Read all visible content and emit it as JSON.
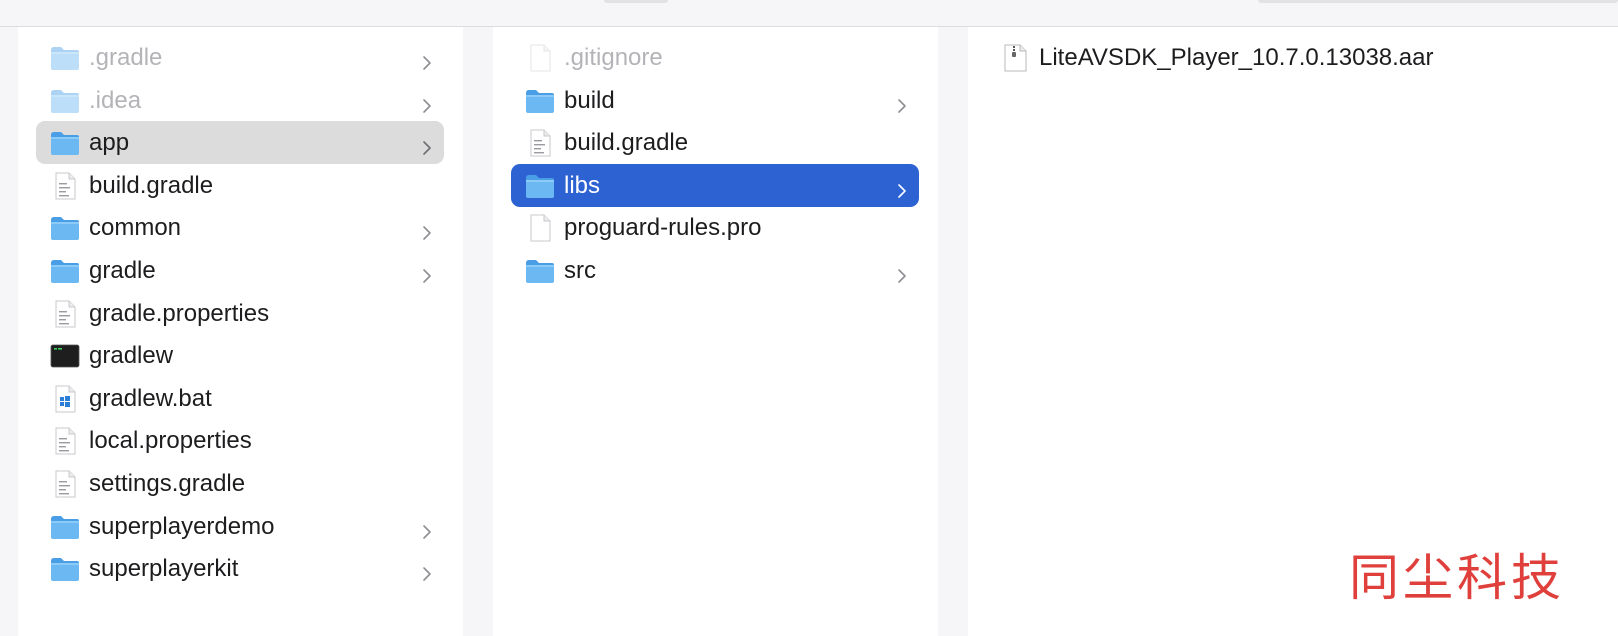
{
  "columns": [
    {
      "name": "root",
      "items": [
        {
          "label": ".gradle",
          "kind": "folder",
          "dim": true,
          "chevron": true,
          "state": "none"
        },
        {
          "label": ".idea",
          "kind": "folder",
          "dim": true,
          "chevron": true,
          "state": "none"
        },
        {
          "label": "app",
          "kind": "folder",
          "dim": false,
          "chevron": true,
          "state": "gray"
        },
        {
          "label": "build.gradle",
          "kind": "textfile",
          "dim": false,
          "chevron": false,
          "state": "none"
        },
        {
          "label": "common",
          "kind": "folder",
          "dim": false,
          "chevron": true,
          "state": "none"
        },
        {
          "label": "gradle",
          "kind": "folder",
          "dim": false,
          "chevron": true,
          "state": "none"
        },
        {
          "label": "gradle.properties",
          "kind": "textfile",
          "dim": false,
          "chevron": false,
          "state": "none"
        },
        {
          "label": "gradlew",
          "kind": "terminal",
          "dim": false,
          "chevron": false,
          "state": "none"
        },
        {
          "label": "gradlew.bat",
          "kind": "batfile",
          "dim": false,
          "chevron": false,
          "state": "none"
        },
        {
          "label": "local.properties",
          "kind": "textfile",
          "dim": false,
          "chevron": false,
          "state": "none"
        },
        {
          "label": "settings.gradle",
          "kind": "textfile",
          "dim": false,
          "chevron": false,
          "state": "none"
        },
        {
          "label": "superplayerdemo",
          "kind": "folder",
          "dim": false,
          "chevron": true,
          "state": "none"
        },
        {
          "label": "superplayerkit",
          "kind": "folder",
          "dim": false,
          "chevron": true,
          "state": "none"
        }
      ]
    },
    {
      "name": "app",
      "items": [
        {
          "label": ".gitignore",
          "kind": "blankfile",
          "dim": true,
          "chevron": false,
          "state": "none"
        },
        {
          "label": "build",
          "kind": "folder",
          "dim": false,
          "chevron": true,
          "state": "none"
        },
        {
          "label": "build.gradle",
          "kind": "textfile",
          "dim": false,
          "chevron": false,
          "state": "none"
        },
        {
          "label": "libs",
          "kind": "folder",
          "dim": false,
          "chevron": true,
          "state": "blue"
        },
        {
          "label": "proguard-rules.pro",
          "kind": "blankfile",
          "dim": false,
          "chevron": false,
          "state": "none"
        },
        {
          "label": "src",
          "kind": "folder",
          "dim": false,
          "chevron": true,
          "state": "none"
        }
      ]
    },
    {
      "name": "libs",
      "items": [
        {
          "label": "LiteAVSDK_Player_10.7.0.13038.aar",
          "kind": "archive",
          "dim": false,
          "chevron": false,
          "state": "none"
        }
      ]
    }
  ],
  "watermark": "同尘科技",
  "colors": {
    "selection_blue": "#2d62d3",
    "selection_gray": "#dcdcdc",
    "folder_blue": "#5aaef0",
    "watermark_red": "#e0403c"
  }
}
